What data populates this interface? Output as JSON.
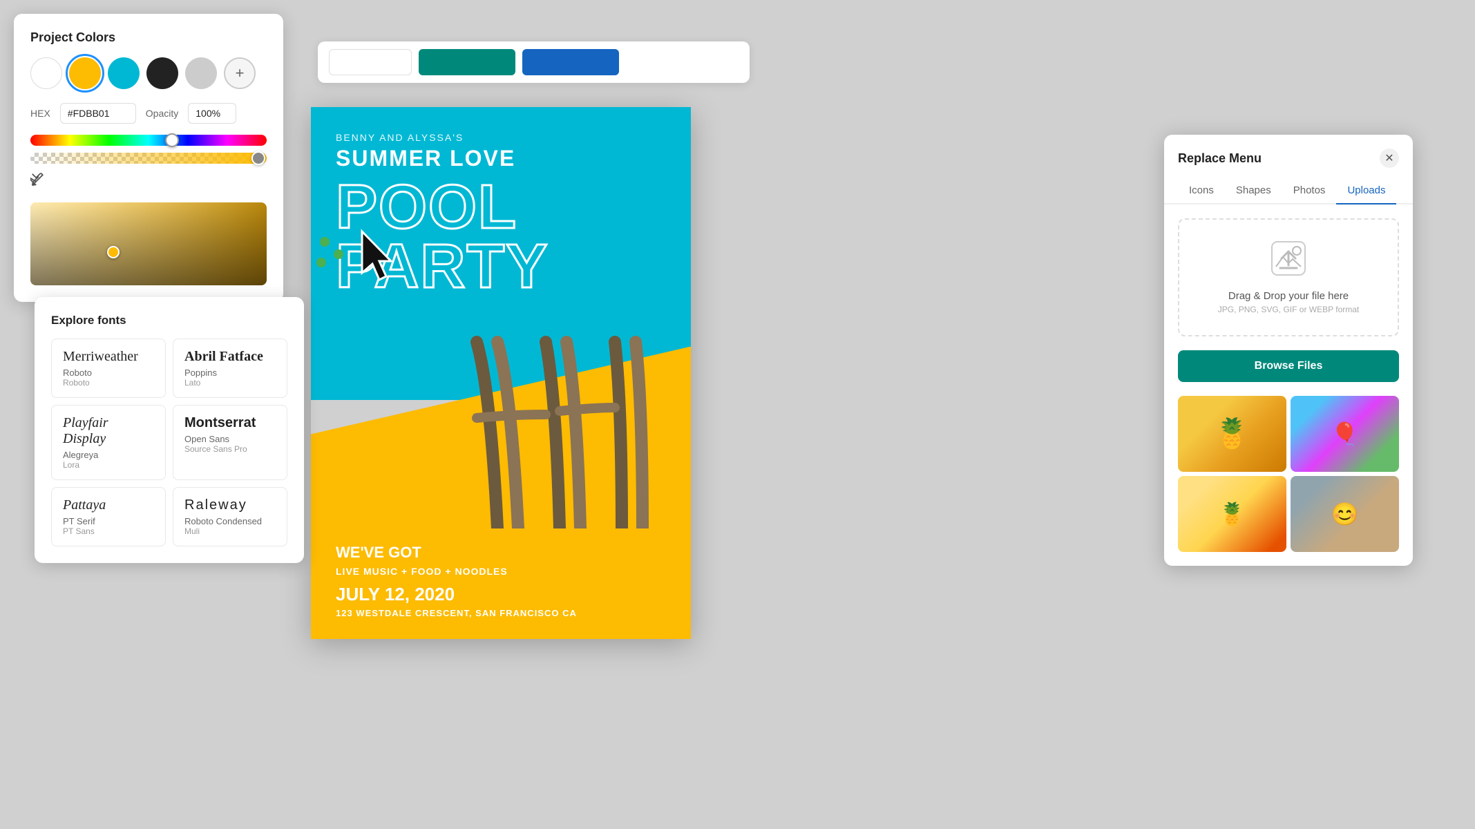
{
  "colorPanel": {
    "title": "Project Colors",
    "swatches": [
      {
        "name": "white",
        "color": "#FFFFFF"
      },
      {
        "name": "yellow",
        "color": "#FDBB01",
        "selected": true
      },
      {
        "name": "cyan",
        "color": "#00B8D4"
      },
      {
        "name": "black",
        "color": "#222222"
      },
      {
        "name": "gray",
        "color": "#CCCCCC"
      }
    ],
    "hexLabel": "HEX",
    "hexValue": "#FDBB01",
    "opacityLabel": "Opacity",
    "opacityValue": "100%"
  },
  "toolbar": {
    "btn1": "",
    "btn2": "",
    "btn3": ""
  },
  "poster": {
    "subtitleTop": "BENNY AND ALYSSA'S",
    "titleSummer": "SUMMER LOVE",
    "titleLine1": "POOL",
    "titleLine2": "PARTY",
    "weveGot": "WE'VE GOT",
    "amenities": "LIVE MUSIC + FOOD + NOODLES",
    "date": "JULY 12, 2020",
    "address": "123 WESTDALE CRESCENT,  SAN FRANCISCO CA"
  },
  "fontPanel": {
    "title": "Explore fonts",
    "fonts": [
      {
        "primary": "Merriweather",
        "secondary": "Roboto",
        "third": "Roboto"
      },
      {
        "primary": "Abril Fatface",
        "secondary": "Poppins",
        "third": "Lato"
      },
      {
        "primary": "Playfair Display",
        "secondary": "Alegreya",
        "third": "Lora"
      },
      {
        "primary": "Montserrat",
        "secondary": "Open Sans",
        "third": "Source Sans Pro"
      },
      {
        "primary": "Pattaya",
        "secondary": "PT Serif",
        "third": "PT Sans"
      },
      {
        "primary": "Raleway",
        "secondary": "Roboto Condensed",
        "third": "Muli"
      }
    ]
  },
  "replaceMenu": {
    "title": "Replace Menu",
    "tabs": [
      "Icons",
      "Shapes",
      "Photos",
      "Uploads"
    ],
    "activeTab": "Uploads",
    "dropZoneTitle": "Drag & Drop your file here",
    "dropZoneSubtitle": "JPG, PNG, SVG, GIF or WEBP format",
    "browseLabel": "Browse Files"
  }
}
